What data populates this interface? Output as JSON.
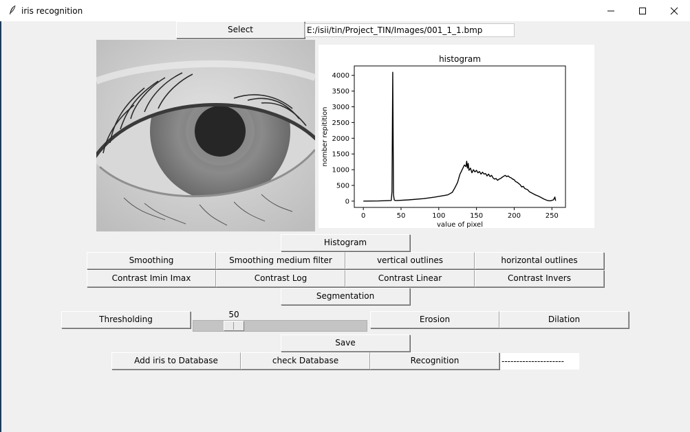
{
  "window": {
    "title": "iris recognition",
    "icon": "feather-icon"
  },
  "toolbar": {
    "select_label": "Select",
    "path_value": "E:/isii/tin/Project_TIN/Images/001_1_1.bmp"
  },
  "buttons": {
    "histogram": "Histogram",
    "smoothing": "Smoothing",
    "smoothing_median": "Smoothing medium filter",
    "vertical_outlines": "vertical outlines",
    "horizontal_outlines": "horizontal outlines",
    "contrast_imin_imax": "Contrast Imin Imax",
    "contrast_log": "Contrast Log",
    "contrast_linear": "Contrast Linear",
    "contrast_invers": "Contrast Invers",
    "segmentation": "Segmentation",
    "thresholding": "Thresholding",
    "erosion": "Erosion",
    "dilation": "Dilation",
    "save": "Save",
    "add_iris": "Add iris to Database",
    "check_db": "check Database",
    "recognition": "Recognition"
  },
  "threshold": {
    "value": "50",
    "range": [
      0,
      255
    ]
  },
  "result": {
    "text": "---------------------"
  },
  "chart_data": {
    "type": "line",
    "title": "histogram",
    "xlabel": "value of pixel",
    "ylabel": "nomber repitition",
    "xlim": [
      -12,
      268
    ],
    "ylim": [
      -200,
      4300
    ],
    "xticks": [
      0,
      50,
      100,
      150,
      200,
      250
    ],
    "yticks": [
      0,
      500,
      1000,
      1500,
      2000,
      2500,
      3000,
      3500,
      4000
    ],
    "series": [
      {
        "color": "#000000",
        "x": [
          0,
          20,
          37,
          38,
          39,
          40,
          41,
          42,
          45,
          60,
          80,
          95,
          105,
          112,
          118,
          122,
          125,
          128,
          131,
          134,
          136,
          137,
          138,
          139,
          140,
          142,
          144,
          146,
          148,
          150,
          152,
          154,
          156,
          158,
          160,
          162,
          164,
          166,
          168,
          170,
          172,
          174,
          176,
          178,
          180,
          182,
          184,
          186,
          188,
          190,
          192,
          194,
          196,
          198,
          200,
          202,
          204,
          206,
          208,
          210,
          212,
          214,
          216,
          218,
          220,
          224,
          228,
          232,
          236,
          240,
          244,
          248,
          252,
          254,
          255
        ],
        "values": [
          0,
          5,
          20,
          300,
          4100,
          200,
          40,
          20,
          20,
          40,
          80,
          130,
          170,
          200,
          280,
          450,
          600,
          850,
          1000,
          1150,
          1100,
          1270,
          1050,
          1200,
          980,
          1050,
          900,
          1000,
          930,
          980,
          900,
          940,
          860,
          920,
          860,
          880,
          800,
          860,
          780,
          820,
          740,
          700,
          720,
          660,
          700,
          720,
          760,
          790,
          820,
          780,
          800,
          760,
          740,
          700,
          680,
          620,
          600,
          560,
          520,
          450,
          470,
          400,
          380,
          360,
          300,
          250,
          200,
          160,
          110,
          60,
          20,
          10,
          40,
          130,
          10
        ]
      }
    ]
  }
}
